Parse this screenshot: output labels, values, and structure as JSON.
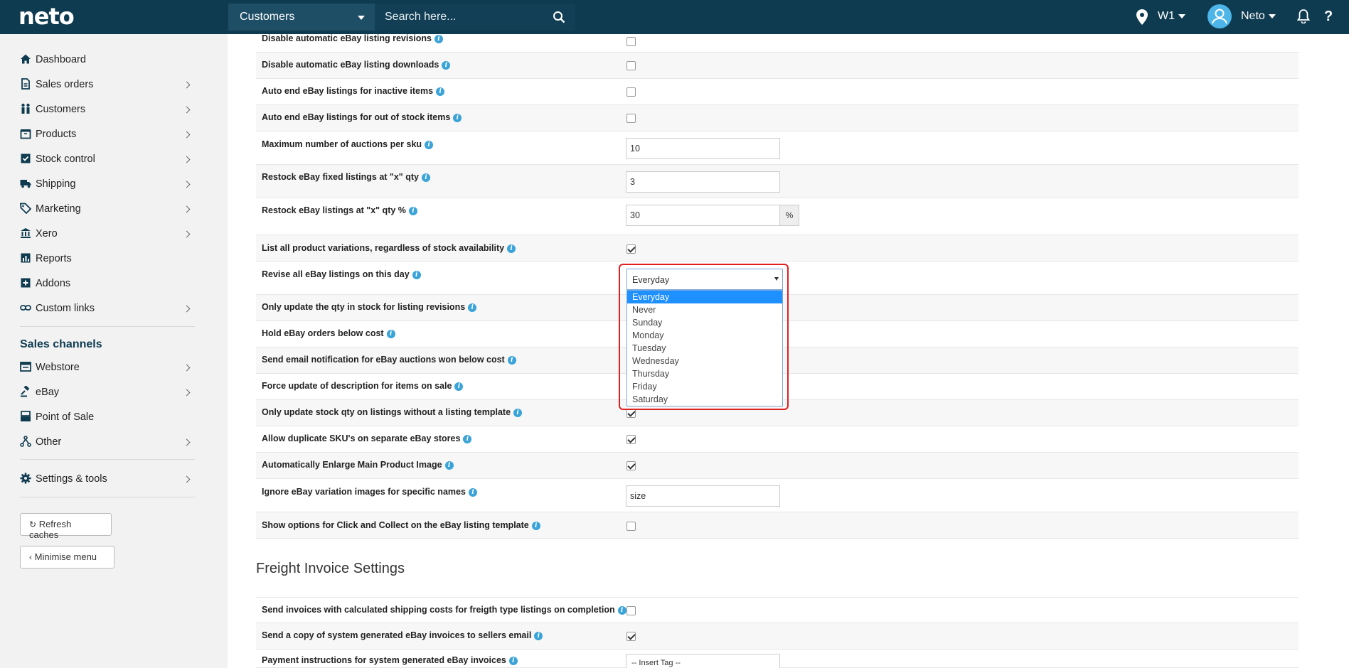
{
  "topbar": {
    "logo": "neto",
    "search_scope": "Customers",
    "search_placeholder": "Search here...",
    "location": "W1",
    "user": "Neto",
    "help": "?"
  },
  "sidebar": {
    "items": [
      {
        "label": "Dashboard",
        "icon": "home-icon"
      },
      {
        "label": "Sales orders",
        "icon": "document-icon"
      },
      {
        "label": "Customers",
        "icon": "people-icon"
      },
      {
        "label": "Products",
        "icon": "box-icon"
      },
      {
        "label": "Stock control",
        "icon": "checkbox-icon"
      },
      {
        "label": "Shipping",
        "icon": "truck-icon"
      },
      {
        "label": "Marketing",
        "icon": "tag-icon"
      },
      {
        "label": "Xero",
        "icon": "bank-icon"
      },
      {
        "label": "Reports",
        "icon": "chart-icon"
      },
      {
        "label": "Addons",
        "icon": "plus-icon"
      },
      {
        "label": "Custom links",
        "icon": "link-icon"
      }
    ],
    "channels_heading": "Sales channels",
    "channels": [
      {
        "label": "Webstore",
        "icon": "browser-icon"
      },
      {
        "label": "eBay",
        "icon": "gavel-icon"
      },
      {
        "label": "Point of Sale",
        "icon": "register-icon"
      },
      {
        "label": "Other",
        "icon": "network-icon"
      }
    ],
    "settings_label": "Settings & tools",
    "refresh_label": "Refresh caches",
    "minimise_label": "Minimise menu"
  },
  "settings": {
    "rows": [
      {
        "label": "Disable automatic eBay listing revisions",
        "type": "checkbox",
        "checked": false
      },
      {
        "label": "Disable automatic eBay listing downloads",
        "type": "checkbox",
        "checked": false
      },
      {
        "label": "Auto end eBay listings for inactive items",
        "type": "checkbox",
        "checked": false
      },
      {
        "label": "Auto end eBay listings for out of stock items",
        "type": "checkbox",
        "checked": false
      },
      {
        "label": "Maximum number of auctions per sku",
        "type": "text",
        "value": "10"
      },
      {
        "label": "Restock eBay fixed listings at \"x\" qty",
        "type": "text",
        "value": "3"
      },
      {
        "label": "Restock eBay listings at \"x\" qty %",
        "type": "text",
        "value": "30",
        "addon": "%"
      },
      {
        "label": "List all product variations, regardless of stock availability",
        "type": "checkbox",
        "checked": true
      },
      {
        "label": "Revise all eBay listings on this day",
        "type": "select",
        "value": "Everyday"
      },
      {
        "label": "Only update the qty in stock for listing revisions",
        "type": "checkbox",
        "checked": false
      },
      {
        "label": "Hold eBay orders below cost",
        "type": "checkbox",
        "checked": false
      },
      {
        "label": "Send email notification for eBay auctions won below cost",
        "type": "checkbox",
        "checked": false
      },
      {
        "label": "Force update of description for items on sale",
        "type": "checkbox",
        "checked": false
      },
      {
        "label": "Only update stock qty on listings without a listing template",
        "type": "checkbox",
        "checked": true
      },
      {
        "label": "Allow duplicate SKU's on separate eBay stores",
        "type": "checkbox",
        "checked": true
      },
      {
        "label": "Automatically Enlarge Main Product Image",
        "type": "checkbox",
        "checked": true
      },
      {
        "label": "Ignore eBay variation images for specific names",
        "type": "text",
        "value": "size"
      },
      {
        "label": "Show options for Click and Collect on the eBay listing template",
        "type": "checkbox",
        "checked": false
      }
    ],
    "freight_title": "Freight Invoice Settings",
    "freight_rows": [
      {
        "label": "Send invoices with calculated shipping costs for freigth type listings on completion",
        "type": "checkbox",
        "checked": false
      },
      {
        "label": "Send a copy of system generated eBay invoices to sellers email",
        "type": "checkbox",
        "checked": true
      },
      {
        "label": "Payment instructions for system generated eBay invoices",
        "type": "select",
        "value": "-- Insert Tag --"
      }
    ]
  },
  "dropdown": {
    "selected": "Everyday",
    "options": [
      "Everyday",
      "Never",
      "Sunday",
      "Monday",
      "Tuesday",
      "Wednesday",
      "Thursday",
      "Friday",
      "Saturday"
    ]
  },
  "colors": {
    "topbar": "#0f3b50",
    "accent": "#3aa3d8",
    "highlight": "#e02020",
    "selected_option": "#1e90ff"
  }
}
